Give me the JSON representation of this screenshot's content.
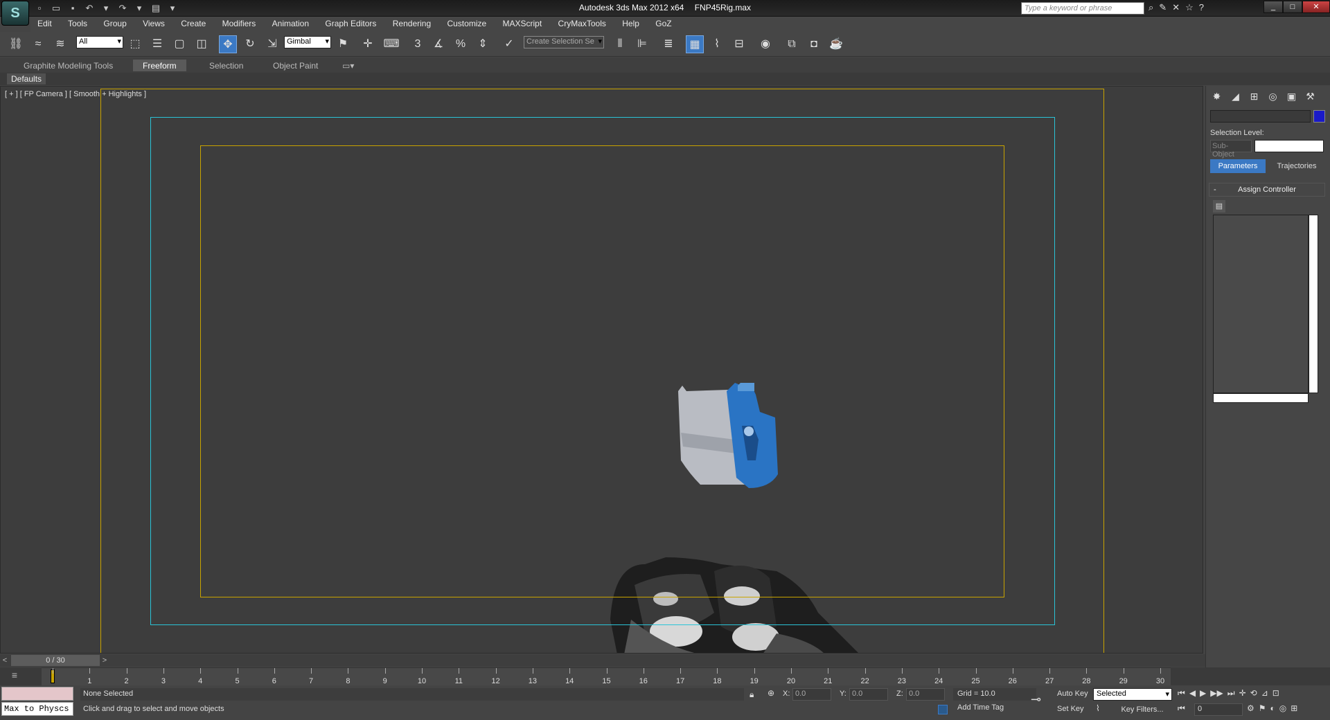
{
  "title": {
    "app": "Autodesk 3ds Max  2012 x64",
    "file": "FNP45Rig.max"
  },
  "search": {
    "placeholder": "Type a keyword or phrase"
  },
  "menu": [
    "Edit",
    "Tools",
    "Group",
    "Views",
    "Create",
    "Modifiers",
    "Animation",
    "Graph Editors",
    "Rendering",
    "Customize",
    "MAXScript",
    "CryMaxTools",
    "Help",
    "GoZ"
  ],
  "toolbar": {
    "selection_filter": "All",
    "ref_coord": "Gimbal",
    "named_selection": "Create Selection Se",
    "snap_angle": "3",
    "snap_percent": "%"
  },
  "ribbon": {
    "tabs": [
      "Graphite Modeling Tools",
      "Freeform",
      "Selection",
      "Object Paint"
    ],
    "active": "Freeform",
    "defaults": "Defaults"
  },
  "viewport": {
    "label": "[ + ] [ FP Camera ] [ Smooth + Highlights ]"
  },
  "command_panel": {
    "selection_level": "Selection Level:",
    "sub_object": "Sub-Object",
    "parameters_btn": "Parameters",
    "trajectories_btn": "Trajectories",
    "rollout_title": "Assign Controller",
    "rollout_toggle": "-",
    "object_color": "#1a1ac8"
  },
  "timeline": {
    "position": "0 / 30",
    "prev": "<",
    "next": ">",
    "ticks": [
      "0",
      "1",
      "2",
      "3",
      "4",
      "5",
      "6",
      "7",
      "8",
      "9",
      "10",
      "11",
      "12",
      "13",
      "14",
      "15",
      "16",
      "17",
      "18",
      "19",
      "20",
      "21",
      "22",
      "23",
      "24",
      "25",
      "26",
      "27",
      "28",
      "29",
      "30"
    ],
    "current_frame": "0"
  },
  "status": {
    "script_listener": "Max to Physcs",
    "selection": "None Selected",
    "prompt": "Click and drag to select and move objects",
    "x_label": "X:",
    "x_value": "0.0",
    "y_label": "Y:",
    "y_value": "0.0",
    "z_label": "Z:",
    "z_value": "0.0",
    "grid": "Grid = 10.0",
    "add_time_tag": "Add Time Tag",
    "auto_key": "Auto Key",
    "set_key": "Set Key",
    "key_mode": "Selected",
    "key_filters": "Key Filters...",
    "frame_field": "0"
  },
  "colors": {
    "accent": "#3b79c4",
    "safe_frame_outer": "#c9a400",
    "safe_frame_action": "#2ac4d8",
    "viewport_bg": "#3d3d3d",
    "weapon_blue": "#2a74c4"
  }
}
